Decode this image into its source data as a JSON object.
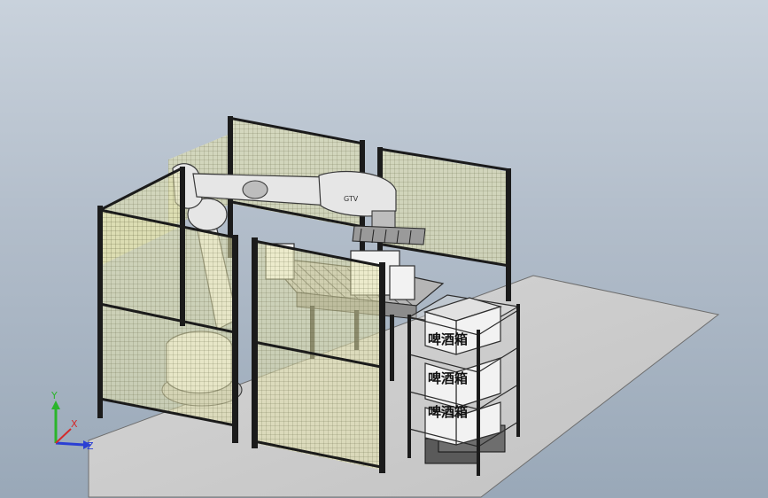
{
  "scene": {
    "box_label": "啤酒箱",
    "robot_mark": "GTV"
  },
  "axes": {
    "y_label": "Y",
    "x_label": "X",
    "z_label": "Z",
    "y_color": "#2bb52b",
    "x_color": "#d42a2a",
    "z_color": "#2a3fd4"
  },
  "colors": {
    "floor": "#cfcfcf",
    "mesh": "#e8e6a8",
    "frame": "#1b1b1b",
    "robot": "#e6e6e6"
  }
}
